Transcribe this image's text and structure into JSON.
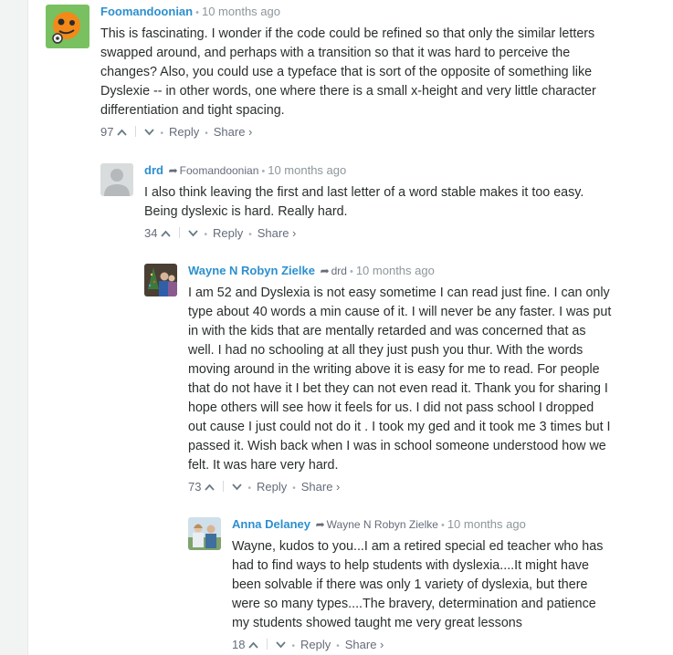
{
  "comments": [
    {
      "author": "Foomandoonian",
      "reply_to": "",
      "time": "10 months ago",
      "text": "This is fascinating. I wonder if the code could be refined so that only the similar letters swapped around, and perhaps with a transition so that it was hard to perceive the changes? Also, you could use a typeface that is sort of the opposite of something like Dyslexie -- in other words, one where there is a small x-height and very little character differentiation and tight spacing.",
      "votes": "97",
      "reply_label": "Reply",
      "share_label": "Share ›"
    },
    {
      "author": "drd",
      "reply_to": "Foomandoonian",
      "time": "10 months ago",
      "text": "I also think leaving the first and last letter of a word stable makes it too easy. Being dyslexic is hard. Really hard.",
      "votes": "34",
      "reply_label": "Reply",
      "share_label": "Share ›"
    },
    {
      "author": "Wayne N Robyn Zielke",
      "reply_to": "drd",
      "time": "10 months ago",
      "text": "I am 52 and Dyslexia is not easy sometime I can read just fine. I can only type about 40 words a min cause of it. I will never be any faster. I was put in with the kids that are mentally retarded and was concerned that as well. I had no schooling at all they just push you thur. With the words moving around in the writing above it is easy for me to read. For people that do not have it I bet they can not even read it. Thank you for sharing I hope others will see how it feels for us. I did not pass school I dropped out cause I just could not do it . I took my ged and it took me 3 times but I passed it. Wish back when I was in school someone understood how we felt. It was hare very hard.",
      "votes": "73",
      "reply_label": "Reply",
      "share_label": "Share ›"
    },
    {
      "author": "Anna Delaney",
      "reply_to": "Wayne N Robyn Zielke",
      "time": "10 months ago",
      "text": "Wayne, kudos to you...I am a retired special ed teacher who has had to find ways to help students with dyslexia....It might have been solvable if there was only 1 variety of dyslexia, but there were so many types....The bravery, determination and patience my students showed taught me very great lessons",
      "votes": "18",
      "reply_label": "Reply",
      "share_label": "Share ›"
    }
  ],
  "icons": {
    "upvote": "upvote-icon",
    "downvote": "downvote-icon",
    "reply_arrow": "reply-arrow-icon"
  },
  "colors": {
    "author": "#2d8fce",
    "meta": "#8d979b",
    "text": "#2a2e2e"
  }
}
